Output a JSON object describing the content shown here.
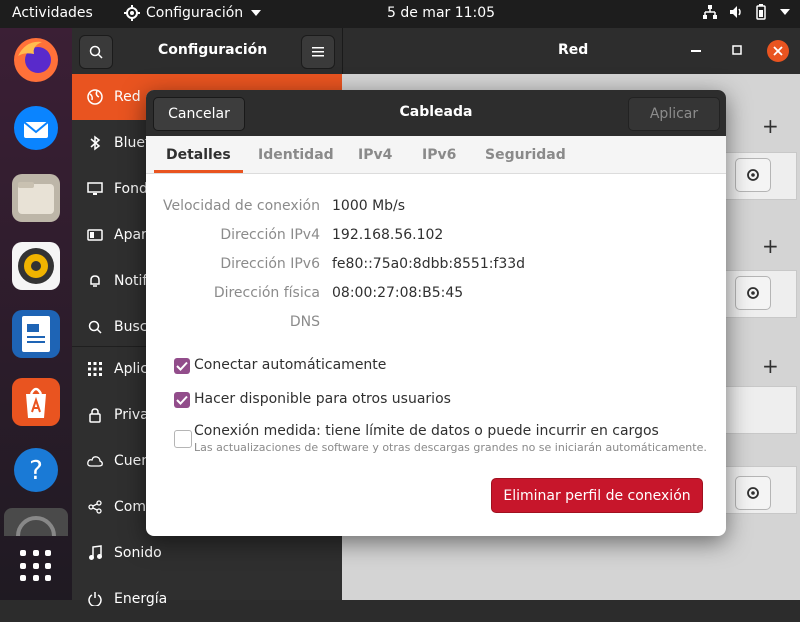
{
  "topbar": {
    "activities": "Actividades",
    "app_menu": "Configuración",
    "clock": "5 de mar  11:05"
  },
  "settings": {
    "title": "Configuración",
    "panel_title": "Red",
    "sidebar_items": [
      {
        "label": "Red",
        "icon": "globe-icon"
      },
      {
        "label": "Bluetooth",
        "icon": "bluetooth-icon"
      },
      {
        "label": "Fondo",
        "icon": "monitor-icon"
      },
      {
        "label": "Apariencia",
        "icon": "appearance-icon"
      },
      {
        "label": "Notificaciones",
        "icon": "bell-icon"
      },
      {
        "label": "Buscar",
        "icon": "search-icon"
      },
      {
        "label": "Aplicaciones",
        "icon": "apps-icon"
      },
      {
        "label": "Privacidad",
        "icon": "lock-icon"
      },
      {
        "label": "Cuentas en línea",
        "icon": "cloud-icon"
      },
      {
        "label": "Compartir",
        "icon": "share-icon"
      },
      {
        "label": "Sonido",
        "icon": "music-note-icon"
      },
      {
        "label": "Energía",
        "icon": "power-icon"
      }
    ]
  },
  "dialog": {
    "title": "Cableada",
    "cancel": "Cancelar",
    "apply": "Aplicar",
    "tabs": [
      "Detalles",
      "Identidad",
      "IPv4",
      "IPv6",
      "Seguridad"
    ],
    "active_tab": "Detalles",
    "details": [
      {
        "label": "Velocidad de conexión",
        "value": "1000 Mb/s"
      },
      {
        "label": "Dirección IPv4",
        "value": "192.168.56.102"
      },
      {
        "label": "Dirección IPv6",
        "value": "fe80::75a0:8dbb:8551:f33d"
      },
      {
        "label": "Dirección física",
        "value": "08:00:27:08:B5:45"
      },
      {
        "label": "DNS",
        "value": ""
      }
    ],
    "checks": [
      {
        "label": "Conectar automáticamente",
        "checked": true
      },
      {
        "label": "Hacer disponible para otros usuarios",
        "checked": true
      },
      {
        "label": "Conexión medida: tiene límite de datos o puede incurrir en cargos",
        "checked": false,
        "sublabel": "Las actualizaciones de software y otras descargas grandes no se iniciarán automáticamente."
      }
    ],
    "delete_button": "Eliminar perfil de conexión"
  },
  "colors": {
    "accent": "#e95420",
    "check": "#924d8b",
    "danger": "#c7162b"
  }
}
